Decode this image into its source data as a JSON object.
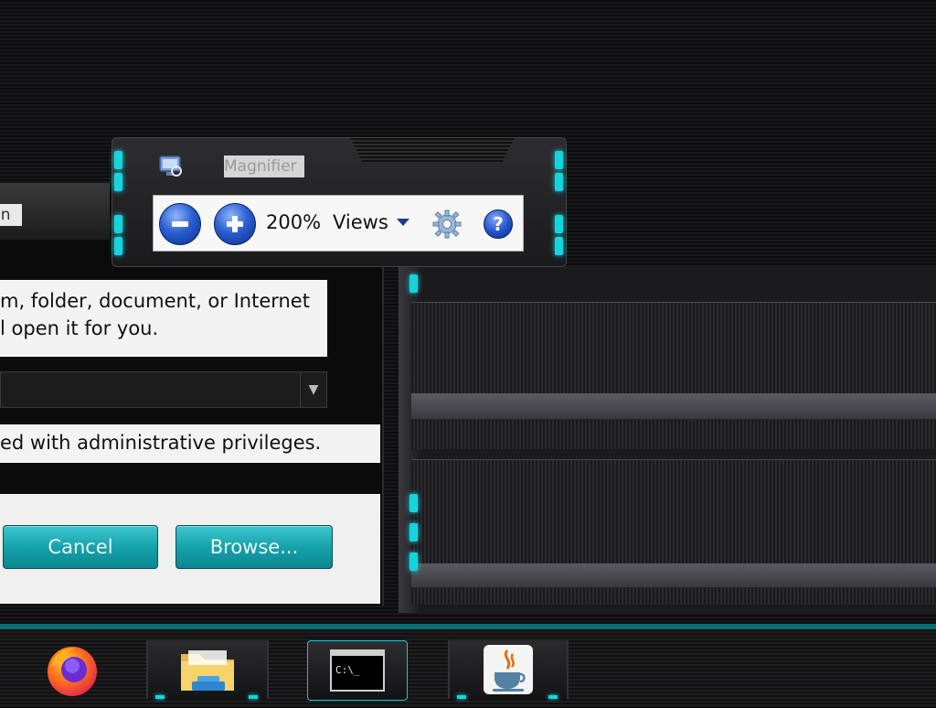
{
  "run_dialog": {
    "title_fragment": "un",
    "description_line1": "m, folder, document, or Internet",
    "description_line2": "l open it for you.",
    "combo_value": "",
    "admin_note": "ed with administrative privileges.",
    "cancel_label": "Cancel",
    "browse_label": "Browse..."
  },
  "magnifier": {
    "title": "Magnifier",
    "zoom_level": "200%",
    "views_label": "Views",
    "icons": {
      "app": "magnifier-app-icon",
      "zoom_out": "minus-icon",
      "zoom_in": "plus-icon",
      "options": "gear-icon",
      "help": "help-icon"
    },
    "help_glyph": "?"
  },
  "taskbar": {
    "items": [
      {
        "name": "Firefox",
        "icon": "firefox-icon"
      },
      {
        "name": "File Explorer",
        "icon": "folder-icon"
      },
      {
        "name": "Command Prompt",
        "icon": "terminal-icon",
        "prompt_text": "C:\\_"
      },
      {
        "name": "Java",
        "icon": "java-icon"
      }
    ]
  },
  "colors": {
    "accent_cyan": "#16d4de",
    "button_teal": "#17a2ac",
    "magnifier_blue": "#2a5fd0"
  }
}
